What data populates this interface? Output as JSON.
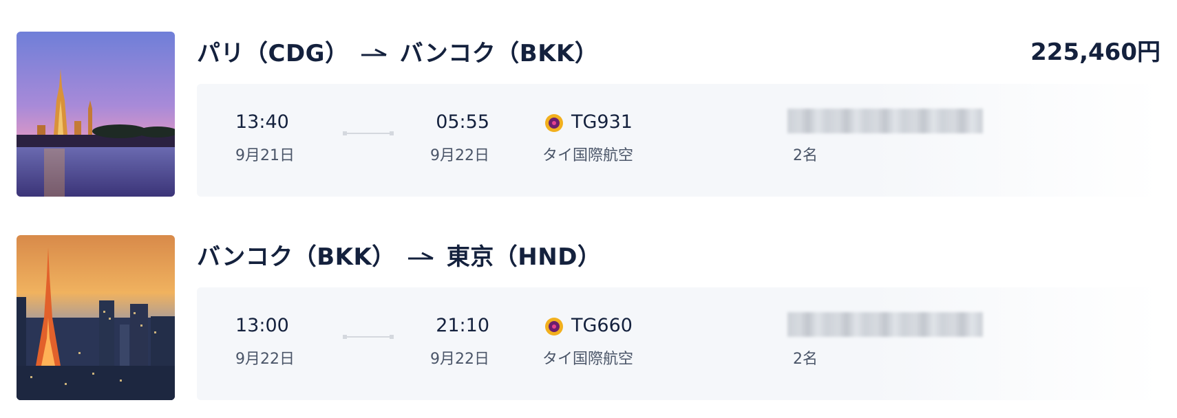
{
  "trip_total_price": "225,460円",
  "flights": [
    {
      "origin": "パリ（CDG）",
      "destination": "バンコク（BKK）",
      "departure_time": "13:40",
      "departure_date": "9月21日",
      "arrival_time": "05:55",
      "arrival_date": "9月22日",
      "flight_number": "TG931",
      "airline": "タイ国際航空",
      "passengers": "2名",
      "photo_subject": "wat-arun-bangkok"
    },
    {
      "origin": "バンコク（BKK）",
      "destination": "東京（HND）",
      "departure_time": "13:00",
      "departure_date": "9月22日",
      "arrival_time": "21:10",
      "arrival_date": "9月22日",
      "flight_number": "TG660",
      "airline": "タイ国際航空",
      "passengers": "2名",
      "photo_subject": "tokyo-tower-skyline"
    }
  ],
  "icons": {
    "route_arrow": "right-arrow-icon",
    "airline_logo": "thai-airways-logo-icon"
  },
  "colors": {
    "text_primary": "#14213d",
    "text_secondary": "#4a5568",
    "card_bg": "#f5f7fa",
    "thai_gold": "#f2b01e",
    "thai_purple": "#6b1f6e"
  }
}
